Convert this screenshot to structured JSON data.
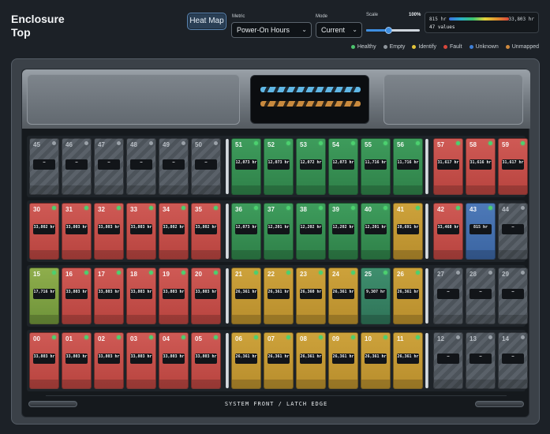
{
  "header": {
    "title_line1": "Enclosure",
    "title_line2": "Top",
    "heat_map_button": "Heat Map",
    "metric_label": "Metric",
    "metric_value": "Power-On Hours",
    "mode_label": "Mode",
    "mode_value": "Current",
    "scale_label": "Scale",
    "scale_percent": "100%",
    "scale_percent_value": 100,
    "scale_min": "815 hr",
    "scale_max": "33,803 hr",
    "scale_count": "47 values"
  },
  "legend": [
    {
      "label": "Healthy",
      "color": "#4cc46e"
    },
    {
      "label": "Empty",
      "color": "#8e959c"
    },
    {
      "label": "Identify",
      "color": "#e3c43a"
    },
    {
      "label": "Fault",
      "color": "#d9473c"
    },
    {
      "label": "Unknown",
      "color": "#3e7fd6"
    },
    {
      "label": "Unmapped",
      "color": "#d08a3e"
    }
  ],
  "footer": {
    "label": "SYSTEM FRONT / LATCH EDGE"
  },
  "rows": [
    [
      {
        "num": "45",
        "state": "empty",
        "value": "—"
      },
      {
        "num": "46",
        "state": "empty",
        "value": "—"
      },
      {
        "num": "47",
        "state": "empty",
        "value": "—"
      },
      {
        "num": "48",
        "state": "empty",
        "value": "—"
      },
      {
        "num": "49",
        "state": "empty",
        "value": "—"
      },
      {
        "num": "50",
        "state": "empty",
        "value": "—"
      },
      {
        "num": "51",
        "state": "healthy",
        "value": "12,073 hr"
      },
      {
        "num": "52",
        "state": "healthy",
        "value": "12,073 hr"
      },
      {
        "num": "53",
        "state": "healthy",
        "value": "12,072 hr"
      },
      {
        "num": "54",
        "state": "healthy",
        "value": "12,073 hr"
      },
      {
        "num": "55",
        "state": "healthy",
        "value": "11,716 hr"
      },
      {
        "num": "56",
        "state": "healthy",
        "value": "11,716 hr"
      },
      {
        "num": "57",
        "state": "fault",
        "value": "31,617 hr"
      },
      {
        "num": "58",
        "state": "fault",
        "value": "31,616 hr"
      },
      {
        "num": "59",
        "state": "fault",
        "value": "31,617 hr"
      }
    ],
    [
      {
        "num": "30",
        "state": "fault",
        "value": "33,802 hr"
      },
      {
        "num": "31",
        "state": "fault",
        "value": "33,803 hr"
      },
      {
        "num": "32",
        "state": "fault",
        "value": "33,803 hr"
      },
      {
        "num": "33",
        "state": "fault",
        "value": "33,803 hr"
      },
      {
        "num": "34",
        "state": "fault",
        "value": "33,802 hr"
      },
      {
        "num": "35",
        "state": "fault",
        "value": "33,802 hr"
      },
      {
        "num": "36",
        "state": "healthy",
        "value": "12,073 hr"
      },
      {
        "num": "37",
        "state": "healthy",
        "value": "12,201 hr"
      },
      {
        "num": "38",
        "state": "healthy",
        "value": "12,202 hr"
      },
      {
        "num": "39",
        "state": "healthy",
        "value": "12,202 hr"
      },
      {
        "num": "40",
        "state": "healthy",
        "value": "12,201 hr"
      },
      {
        "num": "41",
        "state": "warn",
        "value": "28,691 hr"
      },
      {
        "num": "42",
        "state": "fault",
        "value": "33,468 hr"
      },
      {
        "num": "43",
        "state": "blue",
        "value": "815 hr"
      },
      {
        "num": "44",
        "state": "empty",
        "value": "—"
      }
    ],
    [
      {
        "num": "15",
        "state": "lime",
        "value": "17,716 hr"
      },
      {
        "num": "16",
        "state": "fault",
        "value": "33,803 hr"
      },
      {
        "num": "17",
        "state": "fault",
        "value": "33,803 hr"
      },
      {
        "num": "18",
        "state": "fault",
        "value": "33,803 hr"
      },
      {
        "num": "19",
        "state": "fault",
        "value": "33,803 hr"
      },
      {
        "num": "20",
        "state": "fault",
        "value": "33,803 hr"
      },
      {
        "num": "21",
        "state": "warn",
        "value": "26,361 hr"
      },
      {
        "num": "22",
        "state": "warn",
        "value": "26,361 hr"
      },
      {
        "num": "23",
        "state": "warn",
        "value": "26,360 hr"
      },
      {
        "num": "24",
        "state": "warn",
        "value": "26,361 hr"
      },
      {
        "num": "25",
        "state": "teal",
        "value": "9,307 hr"
      },
      {
        "num": "26",
        "state": "warn",
        "value": "26,361 hr"
      },
      {
        "num": "27",
        "state": "empty",
        "value": "—"
      },
      {
        "num": "28",
        "state": "empty",
        "value": "—"
      },
      {
        "num": "29",
        "state": "empty",
        "value": "—"
      }
    ],
    [
      {
        "num": "00",
        "state": "fault",
        "value": "33,803 hr"
      },
      {
        "num": "01",
        "state": "fault",
        "value": "33,803 hr"
      },
      {
        "num": "02",
        "state": "fault",
        "value": "33,803 hr"
      },
      {
        "num": "03",
        "state": "fault",
        "value": "33,803 hr"
      },
      {
        "num": "04",
        "state": "fault",
        "value": "33,803 hr"
      },
      {
        "num": "05",
        "state": "fault",
        "value": "33,803 hr"
      },
      {
        "num": "06",
        "state": "warn",
        "value": "26,361 hr"
      },
      {
        "num": "07",
        "state": "warn",
        "value": "26,361 hr"
      },
      {
        "num": "08",
        "state": "warn",
        "value": "26,361 hr"
      },
      {
        "num": "09",
        "state": "warn",
        "value": "26,361 hr"
      },
      {
        "num": "10",
        "state": "warn",
        "value": "26,361 hr"
      },
      {
        "num": "11",
        "state": "warn",
        "value": "26,361 hr"
      },
      {
        "num": "12",
        "state": "empty",
        "value": "—"
      },
      {
        "num": "13",
        "state": "empty",
        "value": "—"
      },
      {
        "num": "14",
        "state": "empty",
        "value": "—"
      }
    ]
  ]
}
